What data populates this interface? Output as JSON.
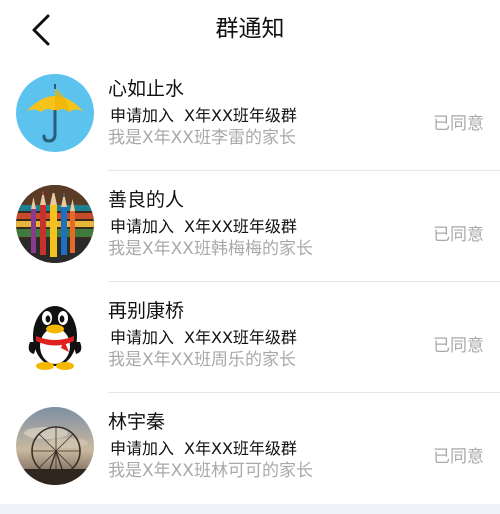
{
  "header": {
    "title": "群通知",
    "back_icon": "chevron-left-icon"
  },
  "notifications": [
    {
      "name": "心如止水",
      "request_action": "申请加入",
      "group": "X年XX班年级群",
      "message": "我是X年XX班李雷的家长",
      "status": "已同意",
      "avatar_icon": "umbrella-avatar"
    },
    {
      "name": "善良的人",
      "request_action": "申请加入",
      "group": "X年XX班年级群",
      "message": "我是X年XX班韩梅梅的家长",
      "status": "已同意",
      "avatar_icon": "colored-pencils-avatar"
    },
    {
      "name": "再别康桥",
      "request_action": "申请加入",
      "group": "X年XX班年级群",
      "message": "我是X年XX班周乐的家长",
      "status": "已同意",
      "avatar_icon": "penguin-avatar"
    },
    {
      "name": "林宇秦",
      "request_action": "申请加入",
      "group": "X年XX班年级群",
      "message": "我是X年XX班林可可的家长",
      "status": "已同意",
      "avatar_icon": "ferris-wheel-sunset-avatar"
    }
  ],
  "colors": {
    "primary_text": "#111111",
    "secondary_text": "#a9a9a9",
    "divider": "#e6e6e6",
    "avatar_umbrella_bg": "#5bc3ee",
    "avatar_umbrella_canopy": "#f6c31a"
  }
}
